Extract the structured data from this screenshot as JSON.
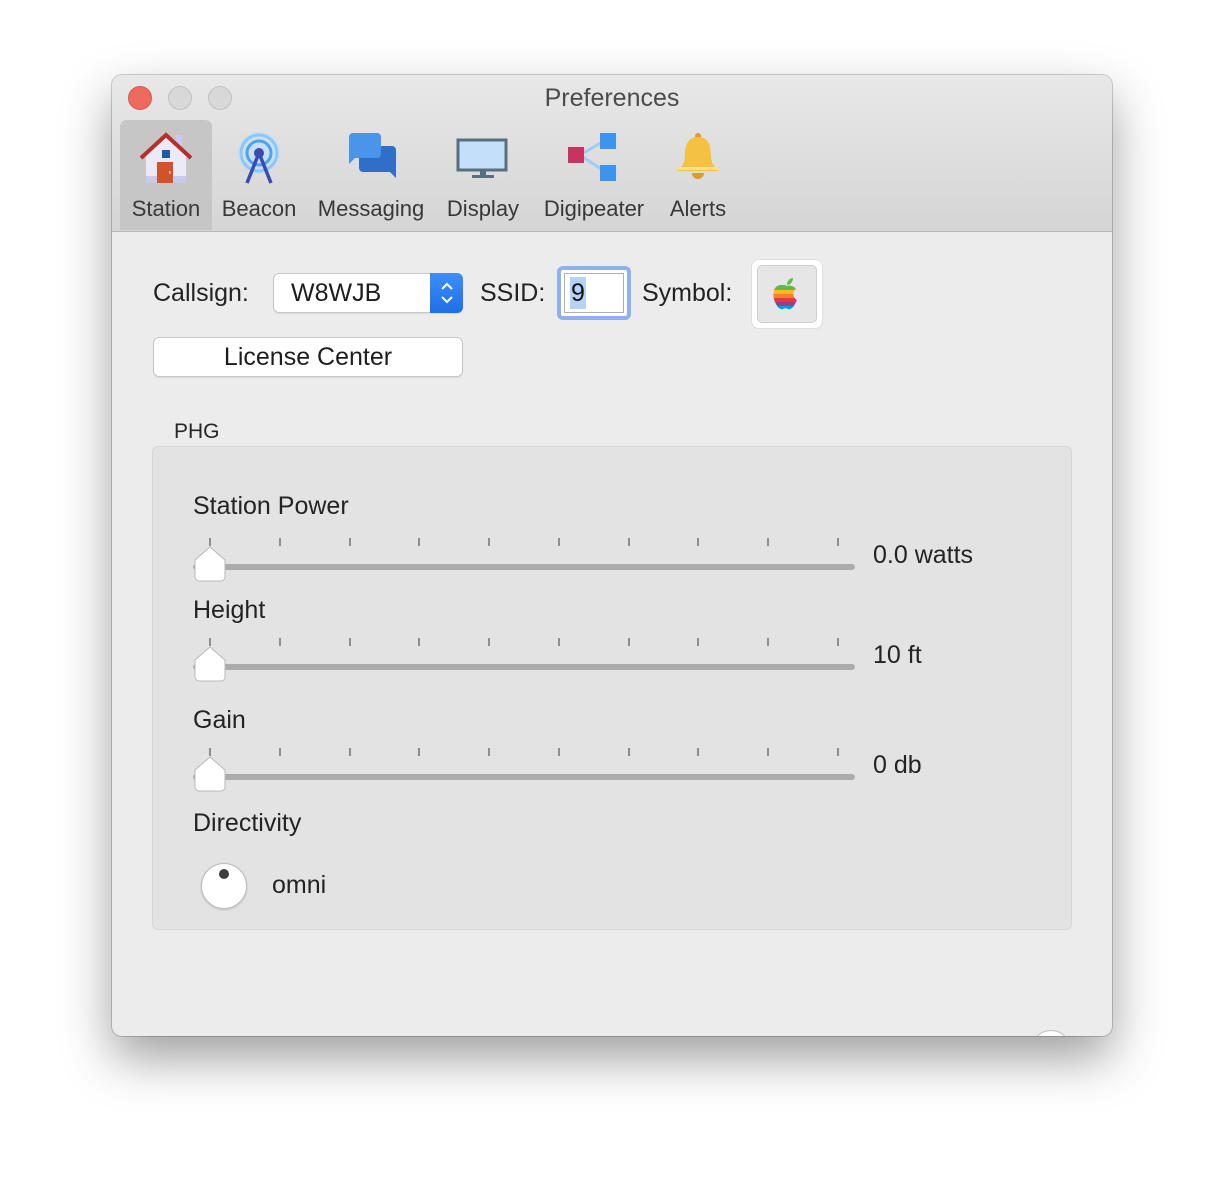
{
  "window": {
    "title": "Preferences",
    "controls": [
      "close",
      "minimize",
      "zoom"
    ]
  },
  "toolbar": {
    "items": [
      {
        "label": "Station",
        "icon": "house-icon",
        "selected": true
      },
      {
        "label": "Beacon",
        "icon": "antenna-icon",
        "selected": false
      },
      {
        "label": "Messaging",
        "icon": "chat-bubbles-icon",
        "selected": false
      },
      {
        "label": "Display",
        "icon": "monitor-icon",
        "selected": false
      },
      {
        "label": "Digipeater",
        "icon": "share-nodes-icon",
        "selected": false
      },
      {
        "label": "Alerts",
        "icon": "bell-icon",
        "selected": false
      }
    ]
  },
  "station": {
    "callsign_label": "Callsign:",
    "callsign_value": "W8WJB",
    "ssid_label": "SSID:",
    "ssid_value": "9",
    "symbol_label": "Symbol:",
    "symbol_icon": "apple-logo-icon",
    "license_button": "License Center"
  },
  "phg": {
    "title": "PHG",
    "sliders": [
      {
        "name": "Station Power",
        "value_text": "0.0 watts",
        "position": 0,
        "tick_count": 10
      },
      {
        "name": "Height",
        "value_text": "10 ft",
        "position": 0,
        "tick_count": 10
      },
      {
        "name": "Gain",
        "value_text": "0 db",
        "position": 0,
        "tick_count": 10
      }
    ],
    "directivity_label": "Directivity",
    "directivity_value": "omni"
  },
  "help_button": "?",
  "colors": {
    "close": "#ee6a5f",
    "accent": "#2b7bf0",
    "focus_ring": "#8fb0ee",
    "selection": "#b5d3f7"
  }
}
